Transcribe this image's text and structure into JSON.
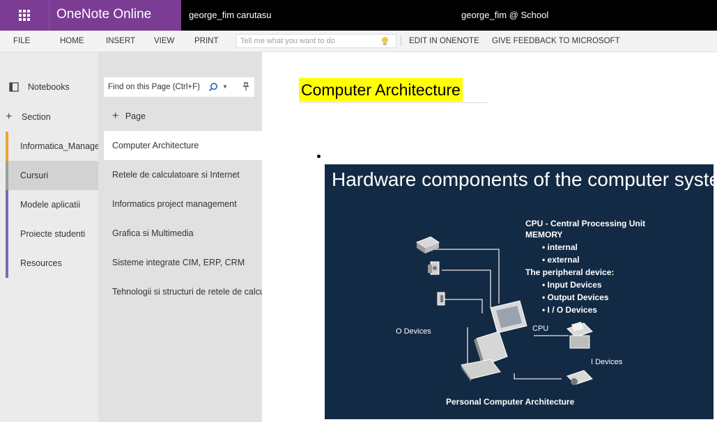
{
  "app": {
    "name": "OneNote Online",
    "notebook": "george_fim carutasu",
    "user": "george_fim @ School"
  },
  "ribbon": {
    "tabs": [
      "FILE",
      "HOME",
      "INSERT",
      "VIEW",
      "PRINT"
    ],
    "tell_me_placeholder": "Tell me what you want to do",
    "actions": [
      "EDIT IN ONENOTE",
      "GIVE FEEDBACK TO MICROSOFT"
    ]
  },
  "notebooks": {
    "label": "Notebooks",
    "add_section": "Section",
    "sections": [
      {
        "name": "Informatica_Manager",
        "color": "#f2a33a"
      },
      {
        "name": "Cursuri",
        "color": "#9e9e9e"
      },
      {
        "name": "Modele aplicatii",
        "color": "#7a68b8"
      },
      {
        "name": "Proiecte studenti",
        "color": "#7a68b8"
      },
      {
        "name": "Resources",
        "color": "#7a68b8"
      }
    ]
  },
  "pages": {
    "find_placeholder": "Find on this Page (Ctrl+F)",
    "add_page": "Page",
    "items": [
      "Computer Architecture",
      "Retele de calculatoare si Internet",
      "Informatics project management",
      "Grafica si Multimedia",
      "Sisteme integrate CIM, ERP, CRM",
      "Tehnologii si structuri de retele de calculatoare"
    ]
  },
  "page": {
    "title": "Computer Architecture",
    "slide": {
      "title": "Hardware components of the computer system",
      "cpu_line": "CPU - Central Processing Unit",
      "memory": "MEMORY",
      "memory_items": [
        "internal",
        "external"
      ],
      "peripheral": "The peripheral device:",
      "peripheral_items": [
        "Input Devices",
        "Output Devices",
        "I / O  Devices"
      ],
      "label_o": "O Devices",
      "label_cpu": "CPU",
      "label_i": "I Devices",
      "caption": "Personal Computer Architecture"
    }
  }
}
